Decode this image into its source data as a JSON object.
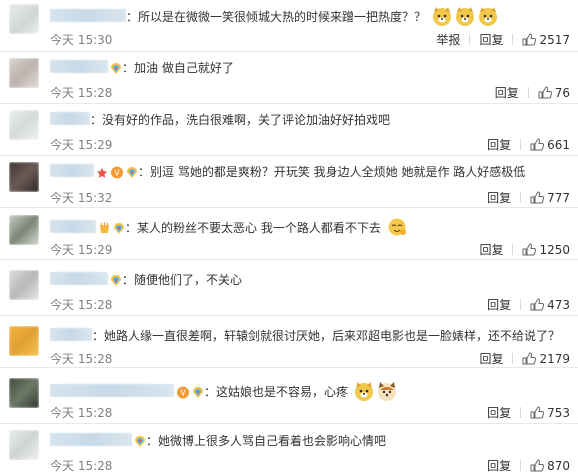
{
  "comments": [
    {
      "text": "所以是在微微一笑很倾城大热的时候来蹭一把热度？？",
      "time": "今天 15:30",
      "report": "举报",
      "reply": "回复",
      "likes": "2517"
    },
    {
      "text": "加油 做自己就好了",
      "time": "今天 15:28",
      "reply": "回复",
      "likes": "76"
    },
    {
      "text": "没有好的作品，洗白很难啊，关了评论加油好好拍戏吧",
      "time": "今天 15:29",
      "reply": "回复",
      "likes": "661"
    },
    {
      "text": "别逗 骂她的都是爽粉？开玩笑 我身边人全烦她 她就是作 路人好感极低",
      "time": "今天 15:32",
      "reply": "回复",
      "likes": "777"
    },
    {
      "text": "某人的粉丝不要太恶心 我一个路人都看不下去",
      "time": "今天 15:29",
      "reply": "回复",
      "likes": "1250"
    },
    {
      "text": "随便他们了，不关心",
      "time": "今天 15:28",
      "reply": "回复",
      "likes": "473"
    },
    {
      "text": "她路人缘一直很差啊，轩辕剑就很讨厌她，后来邓超电影也是一脸婊样，还不给说了？",
      "time": "今天 15:28",
      "reply": "回复",
      "likes": "2179"
    },
    {
      "text": "这姑娘也是不容易，心疼",
      "time": "今天 15:28",
      "reply": "回复",
      "likes": "753"
    },
    {
      "text": "她微博上很多人骂自己看着也会影响心情吧",
      "time": "今天 15:28",
      "reply": "回复",
      "likes": "870"
    }
  ],
  "colors": {
    "text": "#333333",
    "meta": "#808080",
    "divider": "#e8e8e8",
    "username_blur": "#c7d9e7"
  },
  "icons": [
    "thumbs-up-icon",
    "rainbow-badge-icon",
    "doge-emoji-icon",
    "hug-emoji-icon",
    "star-badge-icon"
  ]
}
